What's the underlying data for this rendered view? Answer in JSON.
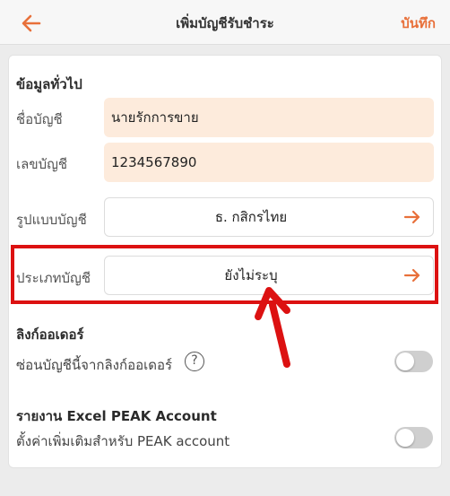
{
  "header": {
    "title": "เพิ่มบัญชีรับชำระ",
    "save_label": "บันทึก",
    "back_icon": "arrow-left-icon",
    "accent": "#e8703a"
  },
  "general": {
    "section_title": "ข้อมูลทั่วไป",
    "account_name_label": "ชื่อบัญชี",
    "account_name_value": "นายรักการขาย",
    "account_number_label": "เลขบัญชี",
    "account_number_value": "1234567890",
    "account_format_label": "รูปแบบบัญชี",
    "account_format_value": "ธ. กสิกรไทย",
    "account_type_label": "ประเภทบัญชี",
    "account_type_value": "ยังไม่ระบุ"
  },
  "order_link": {
    "section_title": "ลิงก์ออเดอร์",
    "hide_label": "ซ่อนบัญชีนี้จากลิงก์ออเดอร์",
    "help_symbol": "?",
    "hide_enabled": false
  },
  "peak": {
    "section_title": "รายงาน Excel PEAK Account",
    "setting_label": "ตั้งค่าเพิ่มเติมสำหรับ PEAK account",
    "enabled": false
  },
  "annotation": {
    "highlight_color": "#dc1111"
  }
}
